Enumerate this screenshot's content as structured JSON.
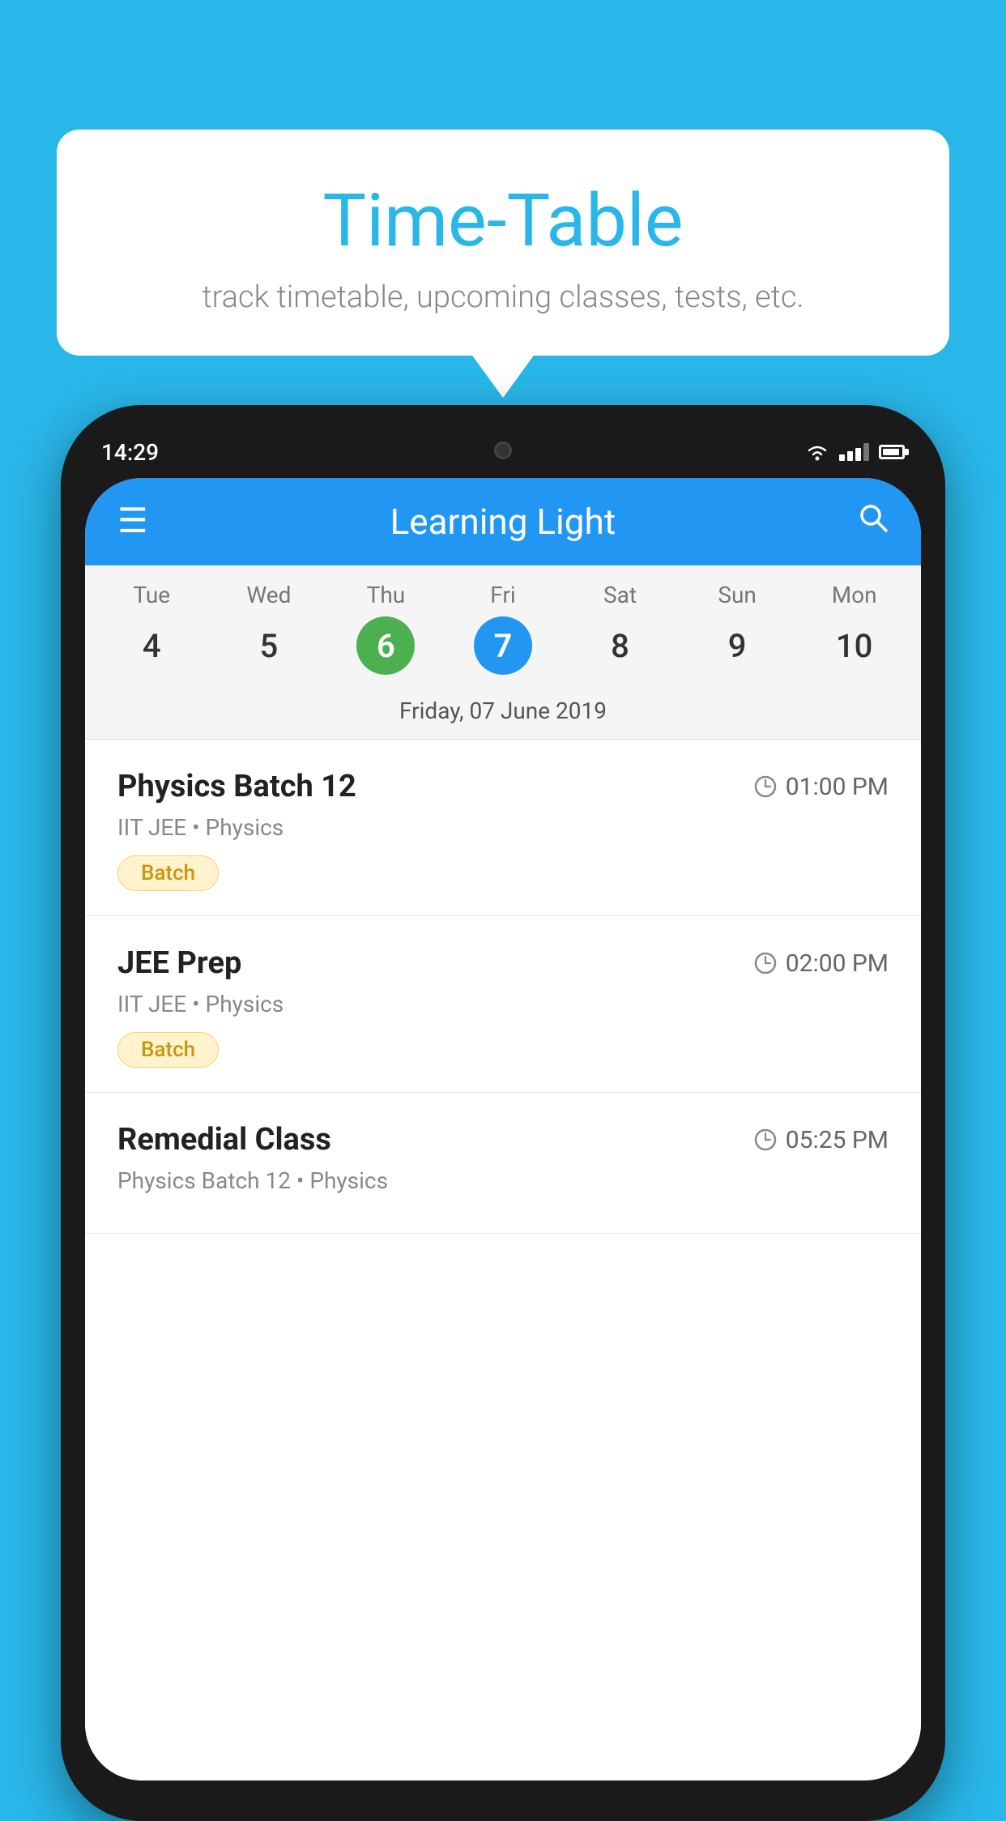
{
  "background_color": "#29B6E8",
  "tooltip": {
    "title": "Time-Table",
    "subtitle": "track timetable, upcoming classes, tests, etc."
  },
  "phone": {
    "status_bar": {
      "time": "14:29"
    },
    "toolbar": {
      "menu_icon": "≡",
      "title": "Learning Light",
      "search_icon": "🔍"
    },
    "calendar": {
      "days": [
        {
          "label": "Tue",
          "number": "4",
          "state": "normal"
        },
        {
          "label": "Wed",
          "number": "5",
          "state": "normal"
        },
        {
          "label": "Thu",
          "number": "6",
          "state": "today"
        },
        {
          "label": "Fri",
          "number": "7",
          "state": "selected"
        },
        {
          "label": "Sat",
          "number": "8",
          "state": "normal"
        },
        {
          "label": "Sun",
          "number": "9",
          "state": "normal"
        },
        {
          "label": "Mon",
          "number": "10",
          "state": "normal"
        }
      ],
      "selected_date_label": "Friday, 07 June 2019"
    },
    "classes": [
      {
        "name": "Physics Batch 12",
        "time": "01:00 PM",
        "subtitle": "IIT JEE • Physics",
        "badge": "Batch"
      },
      {
        "name": "JEE Prep",
        "time": "02:00 PM",
        "subtitle": "IIT JEE • Physics",
        "badge": "Batch"
      },
      {
        "name": "Remedial Class",
        "time": "05:25 PM",
        "subtitle": "Physics Batch 12 • Physics",
        "badge": null
      }
    ]
  }
}
